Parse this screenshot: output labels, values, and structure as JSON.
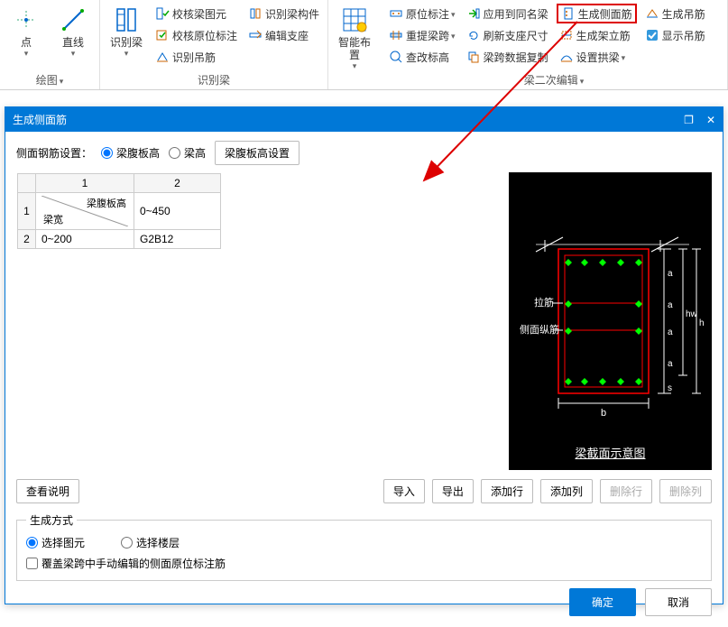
{
  "ribbon": {
    "groups": [
      {
        "label": "绘图",
        "hasDropdown": true,
        "big": [
          {
            "name": "point-btn",
            "label": "点",
            "icon": "dot"
          },
          {
            "name": "line-btn",
            "label": "直线",
            "icon": "line"
          }
        ]
      },
      {
        "label": "识别梁",
        "hasDropdown": false,
        "big": [
          {
            "name": "identify-beam-btn",
            "label": "识别梁",
            "icon": "beam",
            "dd": true
          }
        ],
        "smallCols": [
          [
            {
              "name": "check-beam-element",
              "label": "校核梁图元",
              "icon": "check"
            },
            {
              "name": "check-original-label",
              "label": "校核原位标注",
              "icon": "check2"
            },
            {
              "name": "identify-hanger",
              "label": "识别吊筋",
              "icon": "hanger"
            }
          ],
          [
            {
              "name": "identify-beam-member",
              "label": "识别梁构件",
              "icon": "member"
            },
            {
              "name": "edit-support",
              "label": "编辑支座",
              "icon": "support"
            }
          ]
        ]
      },
      {
        "label": "",
        "big": [
          {
            "name": "smart-layout-btn",
            "label": "智能布置",
            "icon": "grid",
            "dd": true
          }
        ]
      },
      {
        "label": "梁二次编辑",
        "hasDropdown": true,
        "smallCols": [
          [
            {
              "name": "original-label",
              "label": "原位标注",
              "icon": "olabel",
              "dd": true
            },
            {
              "name": "relift-span",
              "label": "重提梁跨",
              "icon": "relift",
              "dd": true
            },
            {
              "name": "check-mark",
              "label": "查改标高",
              "icon": "mark"
            }
          ],
          [
            {
              "name": "apply-same-name",
              "label": "应用到同名梁",
              "icon": "apply"
            },
            {
              "name": "refresh-support",
              "label": "刷新支座尺寸",
              "icon": "refresh"
            },
            {
              "name": "copy-span-data",
              "label": "梁跨数据复制",
              "icon": "copy"
            }
          ],
          [
            {
              "name": "gen-side-bar",
              "label": "生成侧面筋",
              "icon": "sidebar",
              "highlighted": true
            },
            {
              "name": "gen-frame-bar",
              "label": "生成架立筋",
              "icon": "framebar"
            },
            {
              "name": "set-arch-beam",
              "label": "设置拱梁",
              "icon": "arch",
              "dd": true
            }
          ],
          [
            {
              "name": "gen-hanger-bar",
              "label": "生成吊筋",
              "icon": "genhang"
            },
            {
              "name": "show-hanger",
              "label": "显示吊筋",
              "icon": "showhang"
            }
          ]
        ]
      }
    ]
  },
  "modal": {
    "title": "生成侧面筋",
    "settingsLabel": "侧面钢筋设置：",
    "radio1": "梁腹板高",
    "radio2": "梁高",
    "settingsBtn": "梁腹板高设置",
    "table": {
      "colHeaders": [
        "1",
        "2"
      ],
      "diagTop": "梁腹板高",
      "diagBottom": "梁宽",
      "rows": [
        {
          "rh": "1",
          "cells": [
            "",
            "0~450"
          ]
        },
        {
          "rh": "2",
          "cells": [
            "0~200",
            "G2B12"
          ]
        }
      ]
    },
    "previewCaption": "梁截面示意图",
    "previewLabels": {
      "tie": "拉筋",
      "side": "侧面纵筋"
    },
    "buttons": {
      "viewDesc": "查看说明",
      "import": "导入",
      "export": "导出",
      "addRow": "添加行",
      "addCol": "添加列",
      "delRow": "删除行",
      "delCol": "删除列"
    },
    "genMethod": {
      "legend": "生成方式",
      "opt1": "选择图元",
      "opt2": "选择楼层",
      "checkbox": "覆盖梁跨中手动编辑的侧面原位标注筋"
    },
    "ok": "确定",
    "cancel": "取消"
  }
}
